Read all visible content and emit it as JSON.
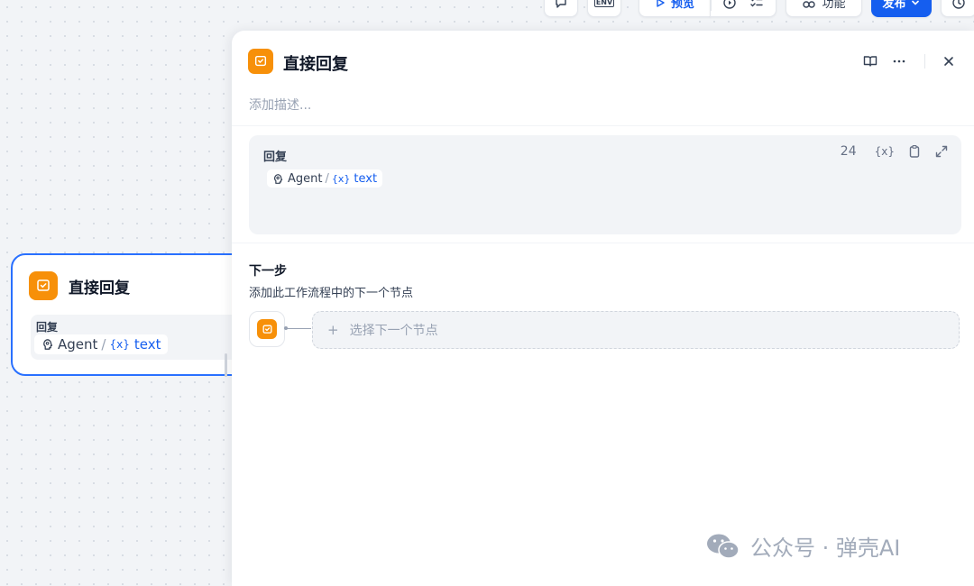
{
  "toolbar": {
    "preview_label": "预览",
    "features_label": "功能",
    "publish_label": "发布",
    "env_label": "ENV"
  },
  "canvas_node": {
    "title": "直接回复",
    "field_label": "回复",
    "var_source": "Agent",
    "var_separator": "/",
    "var_symbol": "{x}",
    "var_name": "text"
  },
  "panel": {
    "title": "直接回复",
    "description_placeholder": "添加描述...",
    "reply": {
      "label": "回复",
      "char_count": "24",
      "insert_var_symbol": "{x}",
      "var_source": "Agent",
      "var_separator": "/",
      "var_symbol": "{x}",
      "var_name": "text"
    },
    "next_step": {
      "title": "下一步",
      "subtitle": "添加此工作流程中的下一个节点",
      "select_plus": "+",
      "select_label": "选择下一个节点"
    }
  },
  "watermark": {
    "text": "公众号 · 弹壳AI"
  },
  "colors": {
    "accent": "#155eef",
    "node_icon": "#f79009",
    "node_border": "#2970ff"
  }
}
